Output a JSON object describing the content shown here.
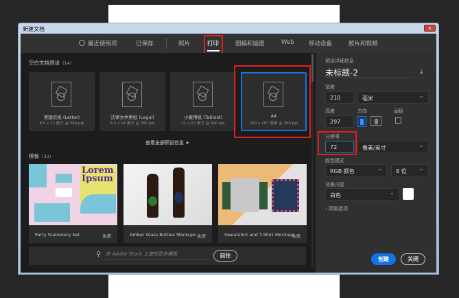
{
  "window": {
    "title": "新建文档",
    "close": "x"
  },
  "tabs": [
    {
      "label": "最近使用项",
      "icon": "clock-icon"
    },
    {
      "label": "已保存"
    },
    {
      "label": "照片"
    },
    {
      "label": "打印",
      "active": true
    },
    {
      "label": "图稿和插图"
    },
    {
      "label": "Web"
    },
    {
      "label": "移动设备"
    },
    {
      "label": "胶片和视频"
    }
  ],
  "presets": {
    "title": "空白文档预设",
    "count": "(14)",
    "view_all": "查看全部预设信息",
    "items": [
      {
        "name": "美国信纸 (Letter)",
        "size": "8.5 x 11 英寸 @ 300 ppi"
      },
      {
        "name": "法律文件用纸 (Legal)",
        "size": "8.5 x 14 英寸 @ 300 ppi"
      },
      {
        "name": "小报用纸 (Tabloid)",
        "size": "11 x 17 英寸 @ 300 ppi"
      },
      {
        "name": "A4",
        "size": "210 x 297 毫米 @ 300 ppi",
        "selected": true
      }
    ]
  },
  "templates": {
    "title": "模板",
    "count": "(33)",
    "items": [
      {
        "name": "Party Stationery Set",
        "price": "免费",
        "art": "Lorem Ipsum"
      },
      {
        "name": "Amber Glass Bottles Mockups",
        "price": "免费"
      },
      {
        "name": "Sweatshirt and T-Shirt Mockups",
        "price": "免费"
      }
    ]
  },
  "stock": {
    "placeholder": "在 Adobe Stock 上查找更多模板",
    "go": "前往"
  },
  "details": {
    "header": "预设详细信息",
    "doc_name": "未标题-2",
    "width_label": "宽度",
    "width": "210",
    "width_unit": "毫米",
    "height_label": "高度",
    "height": "297",
    "orientation_label": "方向",
    "artboard_label": "画板",
    "resolution_label": "分辨率",
    "resolution": "72",
    "resolution_unit": "像素/英寸",
    "color_mode_label": "颜色模式",
    "color_mode": "RGB 颜色",
    "bit_depth": "8 位",
    "background_label": "背景内容",
    "background": "白色",
    "background_color": "#ffffff",
    "advanced": "高级选项"
  },
  "buttons": {
    "create": "创建",
    "close": "关闭"
  },
  "colors": {
    "accent": "#1473e6",
    "highlight": "#e0201b"
  }
}
